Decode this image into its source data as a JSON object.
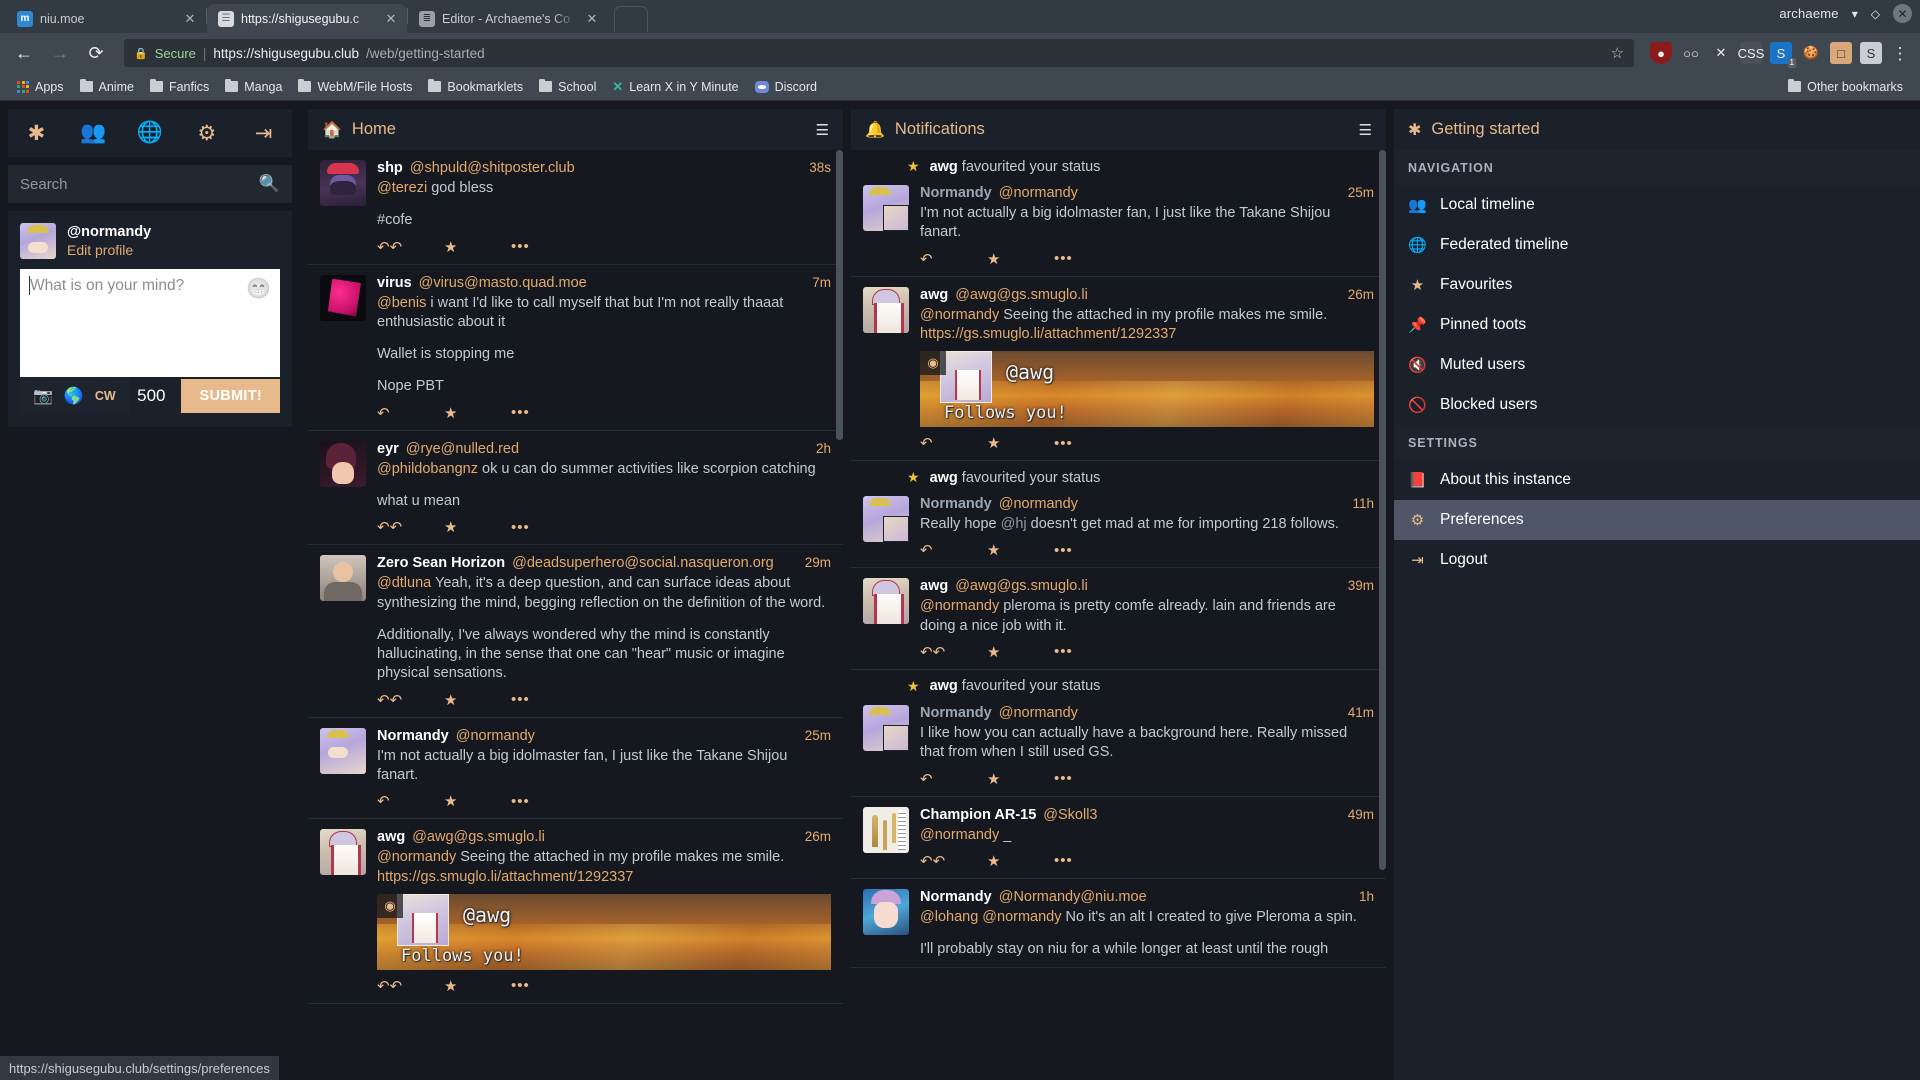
{
  "browser": {
    "tabs": [
      {
        "title": "niu.moe",
        "favicon": "mastodon-icon",
        "active": false
      },
      {
        "title": "https://shigusegubu.c",
        "favicon": "page-icon",
        "active": true
      },
      {
        "title": "Editor - Archaeme's Co",
        "favicon": "editor-icon",
        "active": false
      }
    ],
    "window": {
      "user": "archaeme",
      "minimize": "chevron-down-icon",
      "maximize": "diamond-icon",
      "close": "close-icon"
    },
    "toolbar": {
      "back": "back-arrow-icon",
      "forward": "forward-arrow-icon",
      "reload": "reload-icon",
      "lock": "lock-icon",
      "secure_label": "Secure",
      "url_domain": "https://shigusegubu.club",
      "url_path": "/web/getting-started",
      "bookmark_star": "star-icon",
      "extensions": [
        {
          "name": "ublock-origin-icon",
          "glyph": "●",
          "badge": ""
        },
        {
          "name": "binoculars-icon",
          "glyph": "○○",
          "badge": ""
        },
        {
          "name": "close-x-icon",
          "glyph": "✕",
          "badge": ""
        },
        {
          "name": "css-icon",
          "glyph": "CSS",
          "badge": ""
        },
        {
          "name": "stylus-icon",
          "glyph": "S",
          "badge": "1"
        },
        {
          "name": "cookie-icon",
          "glyph": "🍪",
          "badge": ""
        },
        {
          "name": "box-face-icon",
          "glyph": "□",
          "badge": ""
        },
        {
          "name": "s-badge-icon",
          "glyph": "S",
          "badge": ""
        }
      ],
      "menu": "kebab-menu-icon"
    },
    "bookmarks": [
      {
        "label": "Apps",
        "icon": "apps-grid-icon"
      },
      {
        "label": "Anime",
        "icon": "folder-icon"
      },
      {
        "label": "Fanfics",
        "icon": "folder-icon"
      },
      {
        "label": "Manga",
        "icon": "folder-icon"
      },
      {
        "label": "WebM/File Hosts",
        "icon": "folder-icon"
      },
      {
        "label": "Bookmarklets",
        "icon": "folder-icon"
      },
      {
        "label": "School",
        "icon": "folder-icon"
      },
      {
        "label": "Learn X in Y Minute",
        "icon": "x-logo-icon"
      },
      {
        "label": "Discord",
        "icon": "discord-icon"
      }
    ],
    "other_bookmarks": "Other bookmarks",
    "status_bar_url": "https://shigusegubu.club/settings/preferences"
  },
  "left": {
    "tabbar": [
      {
        "name": "asterisk-icon",
        "glyph": "✱"
      },
      {
        "name": "users-icon",
        "glyph": "👥"
      },
      {
        "name": "globe-icon",
        "glyph": "🌐"
      },
      {
        "name": "gear-icon",
        "glyph": "⚙"
      },
      {
        "name": "logout-icon",
        "glyph": "⇥"
      }
    ],
    "search_placeholder": "Search",
    "search_value": "",
    "account": {
      "handle": "@normandy",
      "edit_profile": "Edit profile"
    },
    "composer": {
      "placeholder": "What is on your mind?",
      "value": "",
      "emoji_icon": "emoji-icon",
      "attach_icon": "camera-icon",
      "scope_icon": "globe-icon",
      "cw_label": "CW",
      "char_count": "500",
      "submit_label": "SUBMIT!"
    }
  },
  "home": {
    "title": "Home",
    "icon": "home-icon",
    "settings_icon": "sliders-icon",
    "posts": [
      {
        "avatar": "ava-shp",
        "display_name": "shp",
        "account": "@shpuld@shitposter.club",
        "time": "38s",
        "paragraphs": [
          [
            {
              "t": "mention",
              "v": "@terezi"
            },
            {
              "t": "text",
              "v": " god bless"
            }
          ],
          [
            {
              "t": "text",
              "v": "#cofe"
            }
          ]
        ],
        "actions": {
          "reply": "reply-all-icon",
          "fav": "star-icon",
          "more": "more-icon"
        }
      },
      {
        "avatar": "ava-virus",
        "display_name": "virus",
        "account": "@virus@masto.quad.moe",
        "time": "7m",
        "paragraphs": [
          [
            {
              "t": "mention",
              "v": "@benis"
            },
            {
              "t": "text",
              "v": " i want I'd like to call myself that but I'm not really thaaat enthusiastic about it"
            }
          ],
          [
            {
              "t": "text",
              "v": "Wallet is stopping me"
            }
          ],
          [
            {
              "t": "text",
              "v": "Nope PBT"
            }
          ]
        ],
        "actions": {
          "reply": "reply-icon",
          "fav": "star-icon",
          "more": "more-icon"
        }
      },
      {
        "avatar": "ava-eyr",
        "display_name": "eyr",
        "account": "@rye@nulled.red",
        "time": "2h",
        "paragraphs": [
          [
            {
              "t": "mention",
              "v": "@phildobangnz"
            },
            {
              "t": "text",
              "v": " ok u can do summer activities like scorpion catching"
            }
          ],
          [
            {
              "t": "text",
              "v": "what u mean"
            }
          ]
        ],
        "actions": {
          "reply": "reply-all-icon",
          "fav": "star-icon",
          "more": "more-icon"
        }
      },
      {
        "avatar": "ava-zero",
        "display_name": "Zero Sean Horizon",
        "account": "@deadsuperhero@social.nasqueron.org",
        "time": "29m",
        "paragraphs": [
          [
            {
              "t": "mention",
              "v": "@dtluna"
            },
            {
              "t": "text",
              "v": " Yeah, it's a deep question, and can surface ideas about synthesizing the mind, begging reflection on the definition of the word."
            }
          ],
          [
            {
              "t": "text",
              "v": "Additionally, I've always wondered why the mind is constantly hallucinating, in the sense that one can \"hear\" music or imagine physical sensations."
            }
          ]
        ],
        "actions": {
          "reply": "reply-all-icon",
          "fav": "star-icon",
          "more": "more-icon"
        }
      },
      {
        "avatar": "ava-normandy",
        "display_name": "Normandy",
        "account": "@normandy",
        "time": "25m",
        "paragraphs": [
          [
            {
              "t": "text",
              "v": "I'm not actually a big idolmaster fan, I just like the Takane Shijou fanart."
            }
          ]
        ],
        "actions": {
          "reply": "reply-icon",
          "fav": "star-icon",
          "more": "more-icon"
        }
      },
      {
        "avatar": "ava-awg",
        "display_name": "awg",
        "account": "@awg@gs.smuglo.li",
        "time": "26m",
        "paragraphs": [
          [
            {
              "t": "mention",
              "v": "@normandy"
            },
            {
              "t": "text",
              "v": " Seeing the attached in my profile makes me smile. "
            },
            {
              "t": "link",
              "v": "https://gs.smuglo.li/attachment/1292337"
            }
          ]
        ],
        "media": {
          "handle": "@awg",
          "caption": "Follows you!",
          "eye_icon": "eye-icon"
        },
        "actions": {
          "reply": "reply-all-icon",
          "fav": "star-icon",
          "more": "more-icon"
        }
      }
    ]
  },
  "notifications": {
    "title": "Notifications",
    "icon": "bell-icon",
    "settings_icon": "sliders-icon",
    "items": [
      {
        "kind": "favourite",
        "label_actor": "awg",
        "label_text": " favourited your status",
        "star_icon": "star-icon",
        "avatar": "ava-notif",
        "display_name": "Normandy",
        "account": "@normandy",
        "time": "25m",
        "paragraphs": [
          [
            {
              "t": "text",
              "v": "I'm not actually a big idolmaster fan, I just like the Takane Shijou fanart."
            }
          ]
        ],
        "actions": {
          "reply": "reply-icon",
          "fav": "star-icon",
          "more": "more-icon"
        }
      },
      {
        "kind": "mention",
        "avatar": "ava-awg",
        "display_name": "awg",
        "account": "@awg@gs.smuglo.li",
        "time": "26m",
        "paragraphs": [
          [
            {
              "t": "mention",
              "v": "@normandy"
            },
            {
              "t": "text",
              "v": " Seeing the attached in my profile makes me smile. "
            },
            {
              "t": "link",
              "v": "https://gs.smuglo.li/attachment/1292337"
            }
          ]
        ],
        "media": {
          "handle": "@awg",
          "caption": "Follows you!",
          "eye_icon": "eye-icon"
        },
        "actions": {
          "reply": "reply-icon",
          "fav": "star-icon",
          "more": "more-icon"
        }
      },
      {
        "kind": "favourite",
        "label_actor": "awg",
        "label_text": " favourited your status",
        "star_icon": "star-icon",
        "avatar": "ava-notif",
        "display_name": "Normandy",
        "account": "@normandy",
        "time": "11h",
        "paragraphs": [
          [
            {
              "t": "text",
              "v": "Really hope "
            },
            {
              "t": "mention-dim",
              "v": "@hj"
            },
            {
              "t": "text",
              "v": " doesn't get mad at me for importing 218 follows."
            }
          ]
        ],
        "actions": {
          "reply": "reply-icon",
          "fav": "star-icon",
          "more": "more-icon"
        }
      },
      {
        "kind": "mention",
        "avatar": "ava-awg",
        "display_name": "awg",
        "account": "@awg@gs.smuglo.li",
        "time": "39m",
        "paragraphs": [
          [
            {
              "t": "mention",
              "v": "@normandy"
            },
            {
              "t": "text",
              "v": " pleroma is pretty comfe already.  lain and friends are doing a nice job with it."
            }
          ]
        ],
        "actions": {
          "reply": "reply-all-icon",
          "fav": "star-icon",
          "more": "more-icon"
        }
      },
      {
        "kind": "favourite",
        "label_actor": "awg",
        "label_text": " favourited your status",
        "star_icon": "star-icon",
        "avatar": "ava-notif",
        "display_name": "Normandy",
        "account": "@normandy",
        "time": "41m",
        "paragraphs": [
          [
            {
              "t": "text",
              "v": "I like how you can actually have a background here.  Really missed that from when I still used GS."
            }
          ]
        ],
        "actions": {
          "reply": "reply-icon",
          "fav": "star-icon",
          "more": "more-icon"
        }
      },
      {
        "kind": "mention",
        "avatar": "ava-skoll",
        "display_name": "Champion AR-15",
        "account": "@Skoll3",
        "time": "49m",
        "paragraphs": [
          [
            {
              "t": "mention",
              "v": "@normandy"
            },
            {
              "t": "text",
              "v": " _"
            }
          ]
        ],
        "actions": {
          "reply": "reply-all-icon",
          "fav": "star-icon",
          "more": "more-icon"
        }
      },
      {
        "kind": "mention",
        "avatar": "ava-niu",
        "display_name": "Normandy",
        "account": "@Normandy@niu.moe",
        "time": "1h",
        "paragraphs": [
          [
            {
              "t": "mention",
              "v": "@lohang"
            },
            {
              "t": "text",
              "v": " "
            },
            {
              "t": "mention",
              "v": "@normandy"
            },
            {
              "t": "text",
              "v": " No it's an alt I created to give Pleroma a spin."
            }
          ],
          [
            {
              "t": "text",
              "v": "I'll probably stay on niu for a while longer at least until the rough"
            }
          ]
        ],
        "actions": null
      }
    ]
  },
  "getting_started": {
    "title": "Getting started",
    "icon": "asterisk-icon",
    "sections": [
      {
        "heading": "NAVIGATION",
        "items": [
          {
            "label": "Local timeline",
            "icon": "users-icon",
            "glyph": "👥",
            "selected": false
          },
          {
            "label": "Federated timeline",
            "icon": "globe-icon",
            "glyph": "🌐",
            "selected": false
          },
          {
            "label": "Favourites",
            "icon": "star-icon",
            "glyph": "★",
            "selected": false
          },
          {
            "label": "Pinned toots",
            "icon": "pin-icon",
            "glyph": "📌",
            "selected": false
          },
          {
            "label": "Muted users",
            "icon": "mute-icon",
            "glyph": "🔇",
            "selected": false
          },
          {
            "label": "Blocked users",
            "icon": "block-icon",
            "glyph": "🚫",
            "selected": false
          }
        ]
      },
      {
        "heading": "SETTINGS",
        "items": [
          {
            "label": "About this instance",
            "icon": "book-icon",
            "glyph": "📕",
            "selected": false
          },
          {
            "label": "Preferences",
            "icon": "gear-icon",
            "glyph": "⚙",
            "selected": true
          },
          {
            "label": "Logout",
            "icon": "logout-icon",
            "glyph": "⇥",
            "selected": false
          }
        ]
      }
    ]
  },
  "colors": {
    "accent": "#e8b98a",
    "link": "#e3a96d",
    "panel": "#1b212b",
    "background": "#15191f",
    "text": "#c3cad2",
    "selected": "#4e5668"
  }
}
